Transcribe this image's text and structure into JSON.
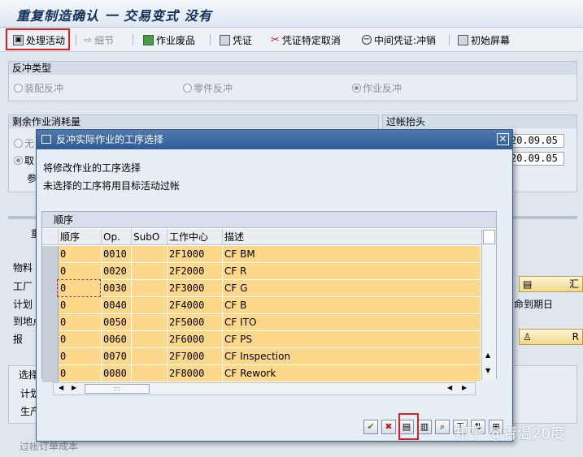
{
  "window": {
    "title": "重复制造确认 一 交易变式 没有"
  },
  "toolbar": {
    "process_label": "处理活动",
    "detail_label": "细节",
    "scrap_label": "作业废品",
    "voucher_label": "凭证",
    "voucher_cancel_label": "凭证特定取消",
    "intermediate_label": "中间凭证:冲销",
    "initial_label": "初始屏幕"
  },
  "background": {
    "reversal_group": "反冲类型",
    "radio_assembly": "装配反冲",
    "radio_component": "零件反冲",
    "radio_activity": "作业反冲",
    "remaining_group": "剩余作业消耗量",
    "posting_group": "过帐抬头",
    "radio_none": "无",
    "radio_take": "取",
    "param_label": "参",
    "date1": "20.09.05",
    "date2": "20.09.05",
    "tab_label": "重",
    "material_label": "物料",
    "plant_label": "工厂",
    "plan_label": "计划",
    "to_site_label": "到地点",
    "report_label": "报",
    "select_label": "选择",
    "plan2_label": "计划",
    "produce_label": "生产",
    "due_label": "命到期日",
    "btn1_label": "汇",
    "btn2_label": "R",
    "bottom_check": "过帐订单成本"
  },
  "dialog": {
    "title": "反冲实际作业的工序选择",
    "msg1": "将修改作业的工序选择",
    "msg2": "未选择的工序将用目标活动过帐",
    "table_title": "顺序",
    "columns": [
      "顺序",
      "Op.",
      "SubO",
      "工作中心",
      "描述"
    ],
    "rows": [
      {
        "seq": "0",
        "op": "0010",
        "subo": "",
        "wc": "2F1000",
        "desc": "CF BM"
      },
      {
        "seq": "0",
        "op": "0020",
        "subo": "",
        "wc": "2F2000",
        "desc": "CF R"
      },
      {
        "seq": "0",
        "op": "0030",
        "subo": "",
        "wc": "2F3000",
        "desc": "CF G"
      },
      {
        "seq": "0",
        "op": "0040",
        "subo": "",
        "wc": "2F4000",
        "desc": "CF B"
      },
      {
        "seq": "0",
        "op": "0050",
        "subo": "",
        "wc": "2F5000",
        "desc": "CF ITO"
      },
      {
        "seq": "0",
        "op": "0060",
        "subo": "",
        "wc": "2F6000",
        "desc": "CF PS"
      },
      {
        "seq": "0",
        "op": "0070",
        "subo": "",
        "wc": "2F7000",
        "desc": "CF Inspection"
      },
      {
        "seq": "0",
        "op": "0080",
        "subo": "",
        "wc": "2F8000",
        "desc": "CF Rework"
      }
    ]
  },
  "watermark": "知乎 @青温20度",
  "colors": {
    "row_highlight": "#fdd88a",
    "title_blue": "#2f5a93",
    "highlight_red": "#e02020"
  }
}
